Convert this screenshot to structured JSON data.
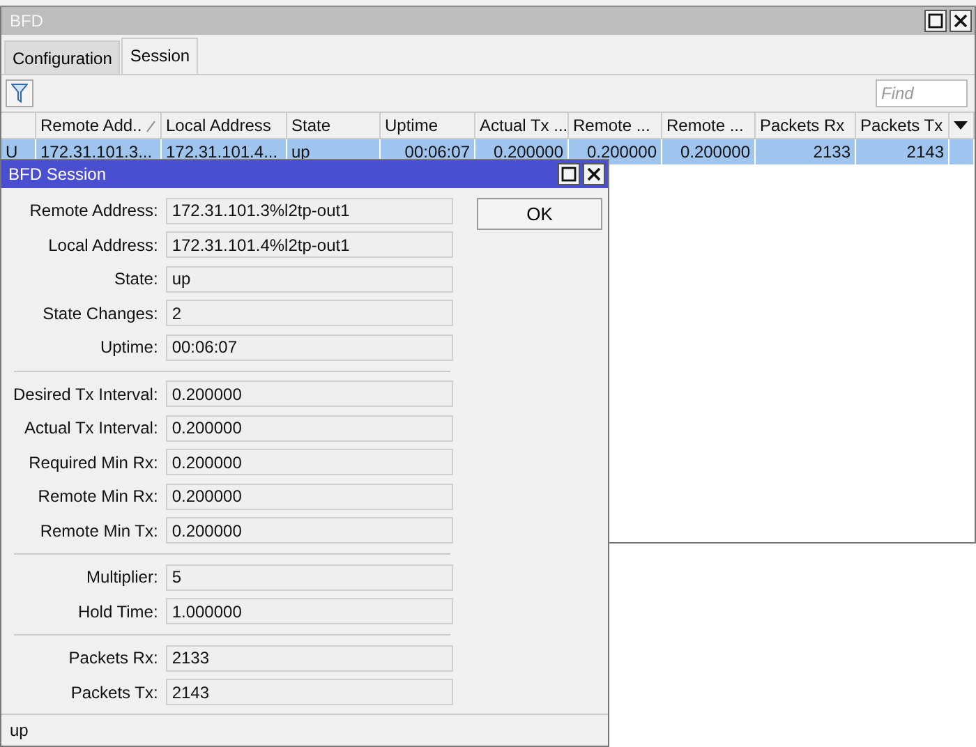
{
  "window": {
    "title": "BFD"
  },
  "tabs": [
    {
      "label": "Configuration",
      "selected": false
    },
    {
      "label": "Session",
      "selected": true
    }
  ],
  "search": {
    "placeholder": "Find"
  },
  "table": {
    "columns": [
      {
        "label": "Remote Add..",
        "sorted": true
      },
      {
        "label": "Local Address",
        "sorted": false
      },
      {
        "label": "State",
        "sorted": false
      },
      {
        "label": "Uptime",
        "sorted": false
      },
      {
        "label": "Actual Tx ...",
        "sorted": false
      },
      {
        "label": "Remote ...",
        "sorted": false
      },
      {
        "label": "Remote ...",
        "sorted": false
      },
      {
        "label": "Packets Rx",
        "sorted": false
      },
      {
        "label": "Packets Tx",
        "sorted": false
      }
    ],
    "rows": [
      {
        "flag": "U",
        "selected": true,
        "cells": [
          "172.31.101.3...",
          "172.31.101.4...",
          "up",
          "00:06:07",
          "0.200000",
          "0.200000",
          "0.200000",
          "2133",
          "2143"
        ]
      }
    ]
  },
  "dialog": {
    "title": "BFD Session",
    "button": "OK",
    "groups": [
      [
        {
          "label": "Remote Address:",
          "value": "172.31.101.3%l2tp-out1"
        },
        {
          "label": "Local Address:",
          "value": "172.31.101.4%l2tp-out1"
        },
        {
          "label": "State:",
          "value": "up"
        },
        {
          "label": "State Changes:",
          "value": "2"
        },
        {
          "label": "Uptime:",
          "value": "00:06:07"
        }
      ],
      [
        {
          "label": "Desired Tx Interval:",
          "value": "0.200000"
        },
        {
          "label": "Actual Tx Interval:",
          "value": "0.200000"
        },
        {
          "label": "Required Min Rx:",
          "value": "0.200000"
        },
        {
          "label": "Remote Min Rx:",
          "value": "0.200000"
        },
        {
          "label": "Remote Min Tx:",
          "value": "0.200000"
        }
      ],
      [
        {
          "label": "Multiplier:",
          "value": "5"
        },
        {
          "label": "Hold Time:",
          "value": "1.000000"
        }
      ],
      [
        {
          "label": "Packets Rx:",
          "value": "2133"
        },
        {
          "label": "Packets Tx:",
          "value": "2143"
        }
      ]
    ],
    "status": "up"
  }
}
